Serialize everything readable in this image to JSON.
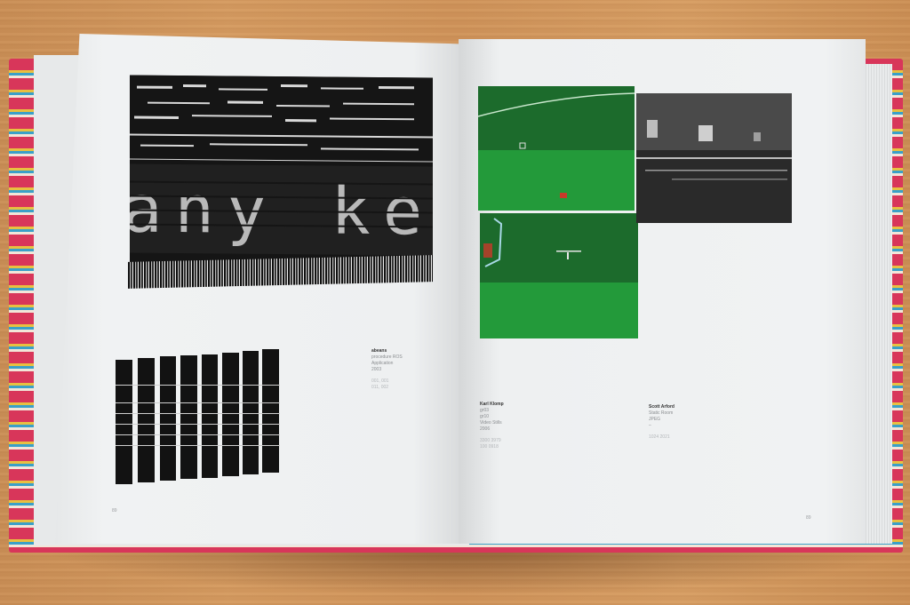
{
  "photo": {
    "subject": "open-book",
    "left_page": {
      "screen_text": "any key",
      "caption": {
        "name": "abeans",
        "title": "procedure ROS",
        "medium": "Application",
        "year": "2003",
        "refs": [
          "001, 001",
          "011, 002"
        ]
      },
      "folio": "89"
    },
    "right_page": {
      "caption_1": {
        "name": "Karl Klomp",
        "lines": [
          "gr03",
          "gr10",
          "Video Stills",
          "2006"
        ],
        "refs": [
          "3300 3979",
          "100 0918"
        ]
      },
      "caption_2": {
        "name": "Scott Arford",
        "lines": [
          "Static Room",
          "JPEG",
          "–"
        ],
        "refs": [
          "1024 2021"
        ]
      },
      "folio": "89"
    }
  }
}
